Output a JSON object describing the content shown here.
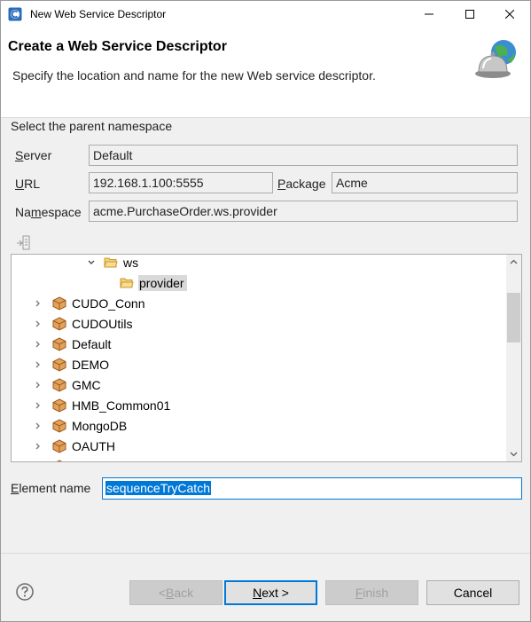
{
  "window": {
    "title": "New Web Service Descriptor",
    "controls": {
      "minimize_icon": "minimize-icon",
      "maximize_icon": "maximize-icon",
      "close_icon": "close-icon"
    }
  },
  "header": {
    "title": "Create a Web Service Descriptor",
    "description": "Specify the location and name for the new Web service descriptor."
  },
  "form": {
    "section_label": "Select the parent namespace",
    "server": {
      "label_u": "S",
      "label_rest": "erver",
      "value": "Default"
    },
    "url": {
      "label_u": "U",
      "label_rest": "RL",
      "value": "192.168.1.100:5555"
    },
    "package": {
      "label_u": "P",
      "label_rest": "ackage",
      "value": "Acme"
    },
    "namespace": {
      "label_pre": "Na",
      "label_u": "m",
      "label_rest": "espace",
      "value": "acme.PurchaseOrder.ws.provider"
    }
  },
  "tree": {
    "rows": [
      {
        "label": "ws",
        "icon": "folder-open-icon",
        "expanded": true
      },
      {
        "label": "provider",
        "icon": "folder-open-icon",
        "selected": true
      },
      {
        "label": "CUDO_Conn",
        "icon": "package-icon"
      },
      {
        "label": "CUDOUtils",
        "icon": "package-icon"
      },
      {
        "label": "Default",
        "icon": "package-icon"
      },
      {
        "label": "DEMO",
        "icon": "package-icon"
      },
      {
        "label": "GMC",
        "icon": "package-icon"
      },
      {
        "label": "HMB_Common01",
        "icon": "package-icon"
      },
      {
        "label": "MongoDB",
        "icon": "package-icon"
      },
      {
        "label": "OAUTH",
        "icon": "package-icon"
      }
    ]
  },
  "element_name": {
    "label_u": "E",
    "label_rest": "lement name",
    "value": "sequenceTryCatch"
  },
  "buttons": {
    "back": {
      "pre": "< ",
      "u": "B",
      "rest": "ack"
    },
    "next": {
      "u": "N",
      "rest": "ext >"
    },
    "finish": {
      "u": "F",
      "rest": "inish"
    },
    "cancel": "Cancel"
  },
  "colors": {
    "accent": "#0078d7",
    "package": "#c8833a",
    "folder": "#e8b13a"
  }
}
